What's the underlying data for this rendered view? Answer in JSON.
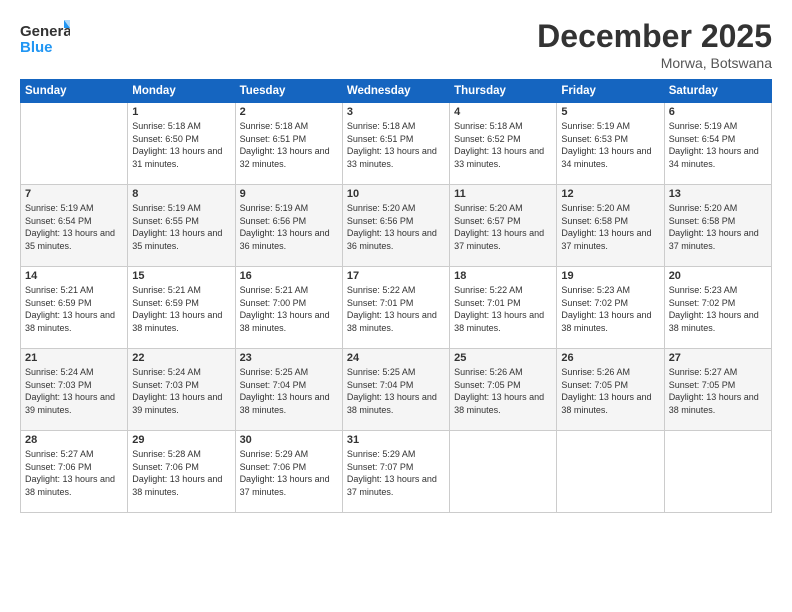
{
  "logo": {
    "line1": "General",
    "line2": "Blue"
  },
  "title": "December 2025",
  "location": "Morwa, Botswana",
  "days_of_week": [
    "Sunday",
    "Monday",
    "Tuesday",
    "Wednesday",
    "Thursday",
    "Friday",
    "Saturday"
  ],
  "weeks": [
    [
      {
        "day": "",
        "sunrise": "",
        "sunset": "",
        "daylight": ""
      },
      {
        "day": "1",
        "sunrise": "Sunrise: 5:18 AM",
        "sunset": "Sunset: 6:50 PM",
        "daylight": "Daylight: 13 hours and 31 minutes."
      },
      {
        "day": "2",
        "sunrise": "Sunrise: 5:18 AM",
        "sunset": "Sunset: 6:51 PM",
        "daylight": "Daylight: 13 hours and 32 minutes."
      },
      {
        "day": "3",
        "sunrise": "Sunrise: 5:18 AM",
        "sunset": "Sunset: 6:51 PM",
        "daylight": "Daylight: 13 hours and 33 minutes."
      },
      {
        "day": "4",
        "sunrise": "Sunrise: 5:18 AM",
        "sunset": "Sunset: 6:52 PM",
        "daylight": "Daylight: 13 hours and 33 minutes."
      },
      {
        "day": "5",
        "sunrise": "Sunrise: 5:19 AM",
        "sunset": "Sunset: 6:53 PM",
        "daylight": "Daylight: 13 hours and 34 minutes."
      },
      {
        "day": "6",
        "sunrise": "Sunrise: 5:19 AM",
        "sunset": "Sunset: 6:54 PM",
        "daylight": "Daylight: 13 hours and 34 minutes."
      }
    ],
    [
      {
        "day": "7",
        "sunrise": "Sunrise: 5:19 AM",
        "sunset": "Sunset: 6:54 PM",
        "daylight": "Daylight: 13 hours and 35 minutes."
      },
      {
        "day": "8",
        "sunrise": "Sunrise: 5:19 AM",
        "sunset": "Sunset: 6:55 PM",
        "daylight": "Daylight: 13 hours and 35 minutes."
      },
      {
        "day": "9",
        "sunrise": "Sunrise: 5:19 AM",
        "sunset": "Sunset: 6:56 PM",
        "daylight": "Daylight: 13 hours and 36 minutes."
      },
      {
        "day": "10",
        "sunrise": "Sunrise: 5:20 AM",
        "sunset": "Sunset: 6:56 PM",
        "daylight": "Daylight: 13 hours and 36 minutes."
      },
      {
        "day": "11",
        "sunrise": "Sunrise: 5:20 AM",
        "sunset": "Sunset: 6:57 PM",
        "daylight": "Daylight: 13 hours and 37 minutes."
      },
      {
        "day": "12",
        "sunrise": "Sunrise: 5:20 AM",
        "sunset": "Sunset: 6:58 PM",
        "daylight": "Daylight: 13 hours and 37 minutes."
      },
      {
        "day": "13",
        "sunrise": "Sunrise: 5:20 AM",
        "sunset": "Sunset: 6:58 PM",
        "daylight": "Daylight: 13 hours and 37 minutes."
      }
    ],
    [
      {
        "day": "14",
        "sunrise": "Sunrise: 5:21 AM",
        "sunset": "Sunset: 6:59 PM",
        "daylight": "Daylight: 13 hours and 38 minutes."
      },
      {
        "day": "15",
        "sunrise": "Sunrise: 5:21 AM",
        "sunset": "Sunset: 6:59 PM",
        "daylight": "Daylight: 13 hours and 38 minutes."
      },
      {
        "day": "16",
        "sunrise": "Sunrise: 5:21 AM",
        "sunset": "Sunset: 7:00 PM",
        "daylight": "Daylight: 13 hours and 38 minutes."
      },
      {
        "day": "17",
        "sunrise": "Sunrise: 5:22 AM",
        "sunset": "Sunset: 7:01 PM",
        "daylight": "Daylight: 13 hours and 38 minutes."
      },
      {
        "day": "18",
        "sunrise": "Sunrise: 5:22 AM",
        "sunset": "Sunset: 7:01 PM",
        "daylight": "Daylight: 13 hours and 38 minutes."
      },
      {
        "day": "19",
        "sunrise": "Sunrise: 5:23 AM",
        "sunset": "Sunset: 7:02 PM",
        "daylight": "Daylight: 13 hours and 38 minutes."
      },
      {
        "day": "20",
        "sunrise": "Sunrise: 5:23 AM",
        "sunset": "Sunset: 7:02 PM",
        "daylight": "Daylight: 13 hours and 38 minutes."
      }
    ],
    [
      {
        "day": "21",
        "sunrise": "Sunrise: 5:24 AM",
        "sunset": "Sunset: 7:03 PM",
        "daylight": "Daylight: 13 hours and 39 minutes."
      },
      {
        "day": "22",
        "sunrise": "Sunrise: 5:24 AM",
        "sunset": "Sunset: 7:03 PM",
        "daylight": "Daylight: 13 hours and 39 minutes."
      },
      {
        "day": "23",
        "sunrise": "Sunrise: 5:25 AM",
        "sunset": "Sunset: 7:04 PM",
        "daylight": "Daylight: 13 hours and 38 minutes."
      },
      {
        "day": "24",
        "sunrise": "Sunrise: 5:25 AM",
        "sunset": "Sunset: 7:04 PM",
        "daylight": "Daylight: 13 hours and 38 minutes."
      },
      {
        "day": "25",
        "sunrise": "Sunrise: 5:26 AM",
        "sunset": "Sunset: 7:05 PM",
        "daylight": "Daylight: 13 hours and 38 minutes."
      },
      {
        "day": "26",
        "sunrise": "Sunrise: 5:26 AM",
        "sunset": "Sunset: 7:05 PM",
        "daylight": "Daylight: 13 hours and 38 minutes."
      },
      {
        "day": "27",
        "sunrise": "Sunrise: 5:27 AM",
        "sunset": "Sunset: 7:05 PM",
        "daylight": "Daylight: 13 hours and 38 minutes."
      }
    ],
    [
      {
        "day": "28",
        "sunrise": "Sunrise: 5:27 AM",
        "sunset": "Sunset: 7:06 PM",
        "daylight": "Daylight: 13 hours and 38 minutes."
      },
      {
        "day": "29",
        "sunrise": "Sunrise: 5:28 AM",
        "sunset": "Sunset: 7:06 PM",
        "daylight": "Daylight: 13 hours and 38 minutes."
      },
      {
        "day": "30",
        "sunrise": "Sunrise: 5:29 AM",
        "sunset": "Sunset: 7:06 PM",
        "daylight": "Daylight: 13 hours and 37 minutes."
      },
      {
        "day": "31",
        "sunrise": "Sunrise: 5:29 AM",
        "sunset": "Sunset: 7:07 PM",
        "daylight": "Daylight: 13 hours and 37 minutes."
      },
      {
        "day": "",
        "sunrise": "",
        "sunset": "",
        "daylight": ""
      },
      {
        "day": "",
        "sunrise": "",
        "sunset": "",
        "daylight": ""
      },
      {
        "day": "",
        "sunrise": "",
        "sunset": "",
        "daylight": ""
      }
    ]
  ]
}
